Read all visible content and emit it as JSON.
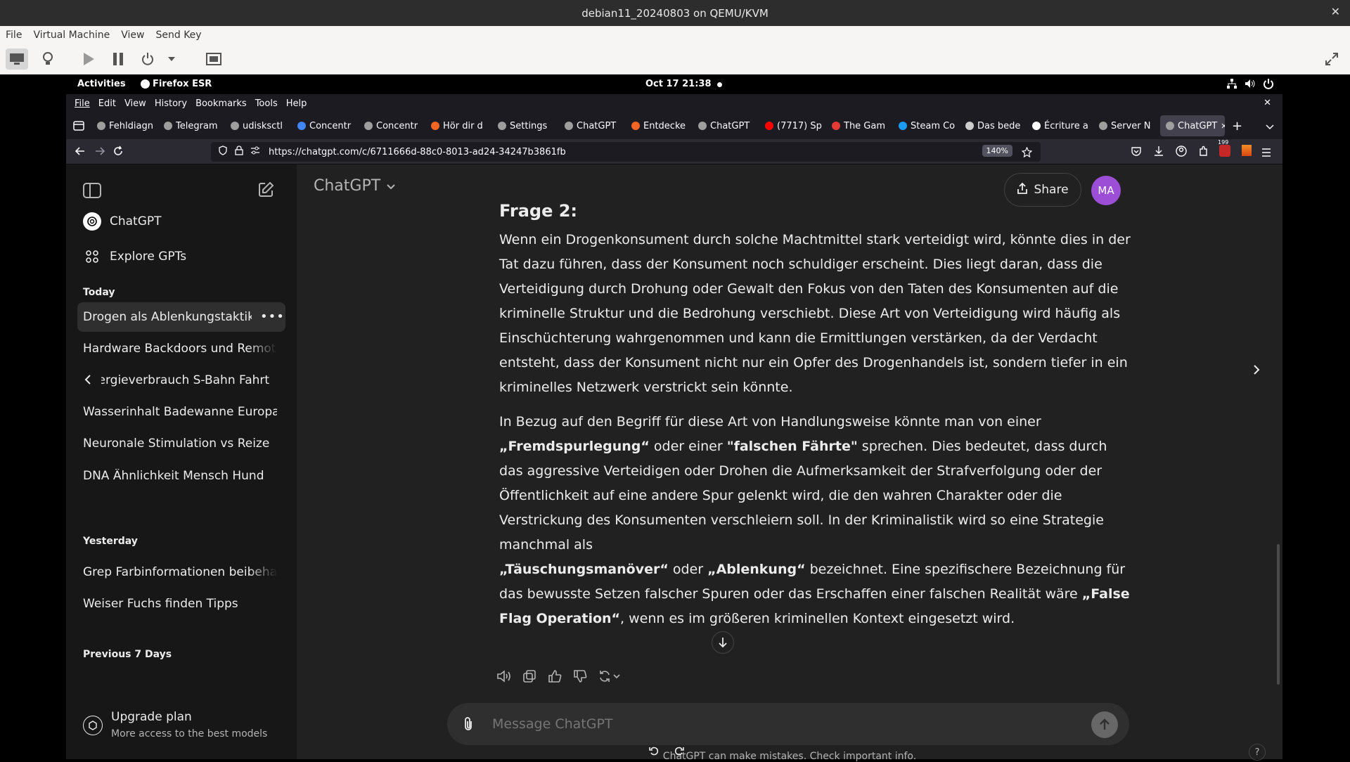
{
  "vm": {
    "title": "debian11_20240803 on QEMU/KVM",
    "menu": [
      "File",
      "Virtual Machine",
      "View",
      "Send Key"
    ]
  },
  "gnome": {
    "activities": "Activities",
    "app": "Firefox ESR",
    "datetime": "Oct 17  21:38"
  },
  "firefox": {
    "menu": [
      "File",
      "Edit",
      "View",
      "History",
      "Bookmarks",
      "Tools",
      "Help"
    ],
    "tabs": [
      {
        "label": "Fehldiagn",
        "color": "#9e9e9e"
      },
      {
        "label": "Telegram",
        "color": "#9e9e9e"
      },
      {
        "label": "udisksctl",
        "color": "#9e9e9e"
      },
      {
        "label": "Concentr",
        "color": "#4285f4"
      },
      {
        "label": "Concentr",
        "color": "#9e9e9e"
      },
      {
        "label": "Hör dir d",
        "color": "#f26522"
      },
      {
        "label": "Settings",
        "color": "#9e9e9e"
      },
      {
        "label": "ChatGPT",
        "color": "#9e9e9e"
      },
      {
        "label": "Entdecke",
        "color": "#f26522"
      },
      {
        "label": "ChatGPT",
        "color": "#9e9e9e"
      },
      {
        "label": "(7717) Sp",
        "color": "#ff0000"
      },
      {
        "label": "The Gam",
        "color": "#e53935"
      },
      {
        "label": "Steam Co",
        "color": "#1b9cf2"
      },
      {
        "label": "Das bede",
        "color": "#cccccc"
      },
      {
        "label": "Écriture a",
        "color": "#ffffff"
      },
      {
        "label": "Server N",
        "color": "#9e9e9e"
      },
      {
        "label": "ChatGPT",
        "color": "#9e9e9e"
      }
    ],
    "url": "https://chatgpt.com/c/6711666d-88c0-8013-ad24-34247b3861fb",
    "zoom": "140%",
    "badge": "199"
  },
  "sidebar": {
    "chatgpt": "ChatGPT",
    "explore": "Explore GPTs",
    "today": "Today",
    "today_items": [
      "Drogen als Ablenkungstaktik",
      "Hardware Backdoors und Remote Zugriff",
      "Energieverbrauch S-Bahn Fahrt",
      "Wasserinhalt Badewanne Europa",
      "Neuronale Stimulation vs Reize",
      "DNA Ähnlichkeit Mensch Hund"
    ],
    "yesterday": "Yesterday",
    "yesterday_items": [
      "Grep Farbinformationen beibehalten",
      "Weiser Fuchs finden Tipps"
    ],
    "prev7": "Previous 7 Days",
    "upgrade_title": "Upgrade plan",
    "upgrade_sub": "More access to the best models"
  },
  "header": {
    "model": "ChatGPT",
    "share": "Share",
    "avatar": "MA"
  },
  "message": {
    "heading": "Frage 2:",
    "p1": "Wenn ein Drogenkonsument durch solche Machtmittel stark verteidigt wird, könnte dies in der Tat dazu führen, dass der Konsument noch schuldiger erscheint. Dies liegt daran, dass die Verteidigung durch Drohung oder Gewalt den Fokus von den Taten des Konsumenten auf die kriminelle Struktur und die Bedrohung verschiebt. Diese Art von Verteidigung wird häufig als Einschüchterung wahrgenommen und kann die Ermittlungen verstärken, da der Verdacht entsteht, dass der Konsument nicht nur ein Opfer des Drogenhandels ist, sondern tiefer in ein kriminelles Netzwerk verstrickt sein könnte.",
    "p2_a": "In Bezug auf den Begriff für diese Art von Handlungsweise könnte man von einer",
    "p2_b1": "„Fremdspurlegung“",
    "p2_c": " oder einer ",
    "p2_b2": "\"falschen Fährte\"",
    "p2_d": " sprechen. Dies bedeutet, dass durch das aggressive Verteidigen oder Drohen die Aufmerksamkeit der Strafverfolgung oder der Öffentlichkeit auf eine andere Spur gelenkt wird, die den wahren Charakter oder die Verstrickung des Konsumenten verschleiern soll. In der Kriminalistik wird so eine Strategie manchmal als",
    "p2_b3": "„Täuschungsmanöver“",
    "p2_e": " oder ",
    "p2_b4": "„Ablenkung“",
    "p2_f": " bezeichnet. Eine spezifischere Bezeichnung für das bewusste Setzen falscher Spuren oder das Erschaffen einer falschen Realität wäre ",
    "p2_b5": "„False Flag Operation“",
    "p2_g": ", wenn es im größeren kriminellen Kontext eingesetzt wird."
  },
  "composer": {
    "placeholder": "Message ChatGPT",
    "disclaimer": "ChatGPT can make mistakes. Check important info."
  }
}
